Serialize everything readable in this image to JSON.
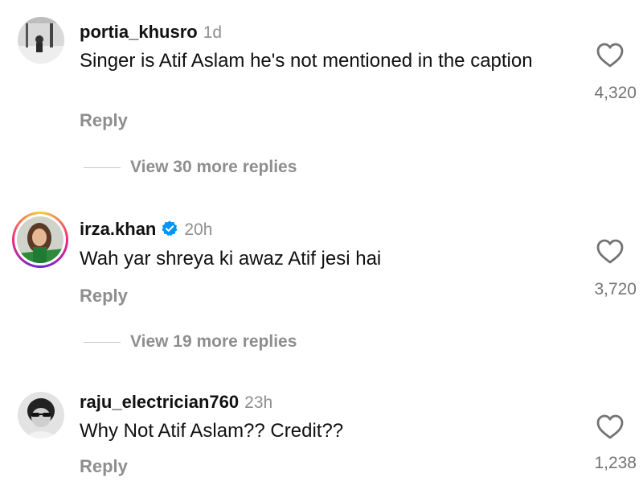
{
  "comments": [
    {
      "username": "portia_khusro",
      "time": "1d",
      "verified": false,
      "text": "Singer is Atif Aslam he's not mentioned in the caption",
      "reply_label": "Reply",
      "likes": "4,320",
      "view_more": "View 30 more replies"
    },
    {
      "username": "irza.khan",
      "time": "20h",
      "verified": true,
      "text": "Wah yar shreya ki awaz Atif jesi hai",
      "reply_label": "Reply",
      "likes": "3,720",
      "view_more": "View 19 more replies"
    },
    {
      "username": "raju_electrician760",
      "time": "23h",
      "verified": false,
      "text": "Why Not Atif Aslam?? Credit??",
      "reply_label": "Reply",
      "likes": "1,238"
    }
  ],
  "icons": {
    "like": "heart-outline-icon",
    "verified": "verified-badge-icon"
  },
  "colors": {
    "verified": "#0095f6",
    "secondary_text": "#8e8e8e"
  }
}
